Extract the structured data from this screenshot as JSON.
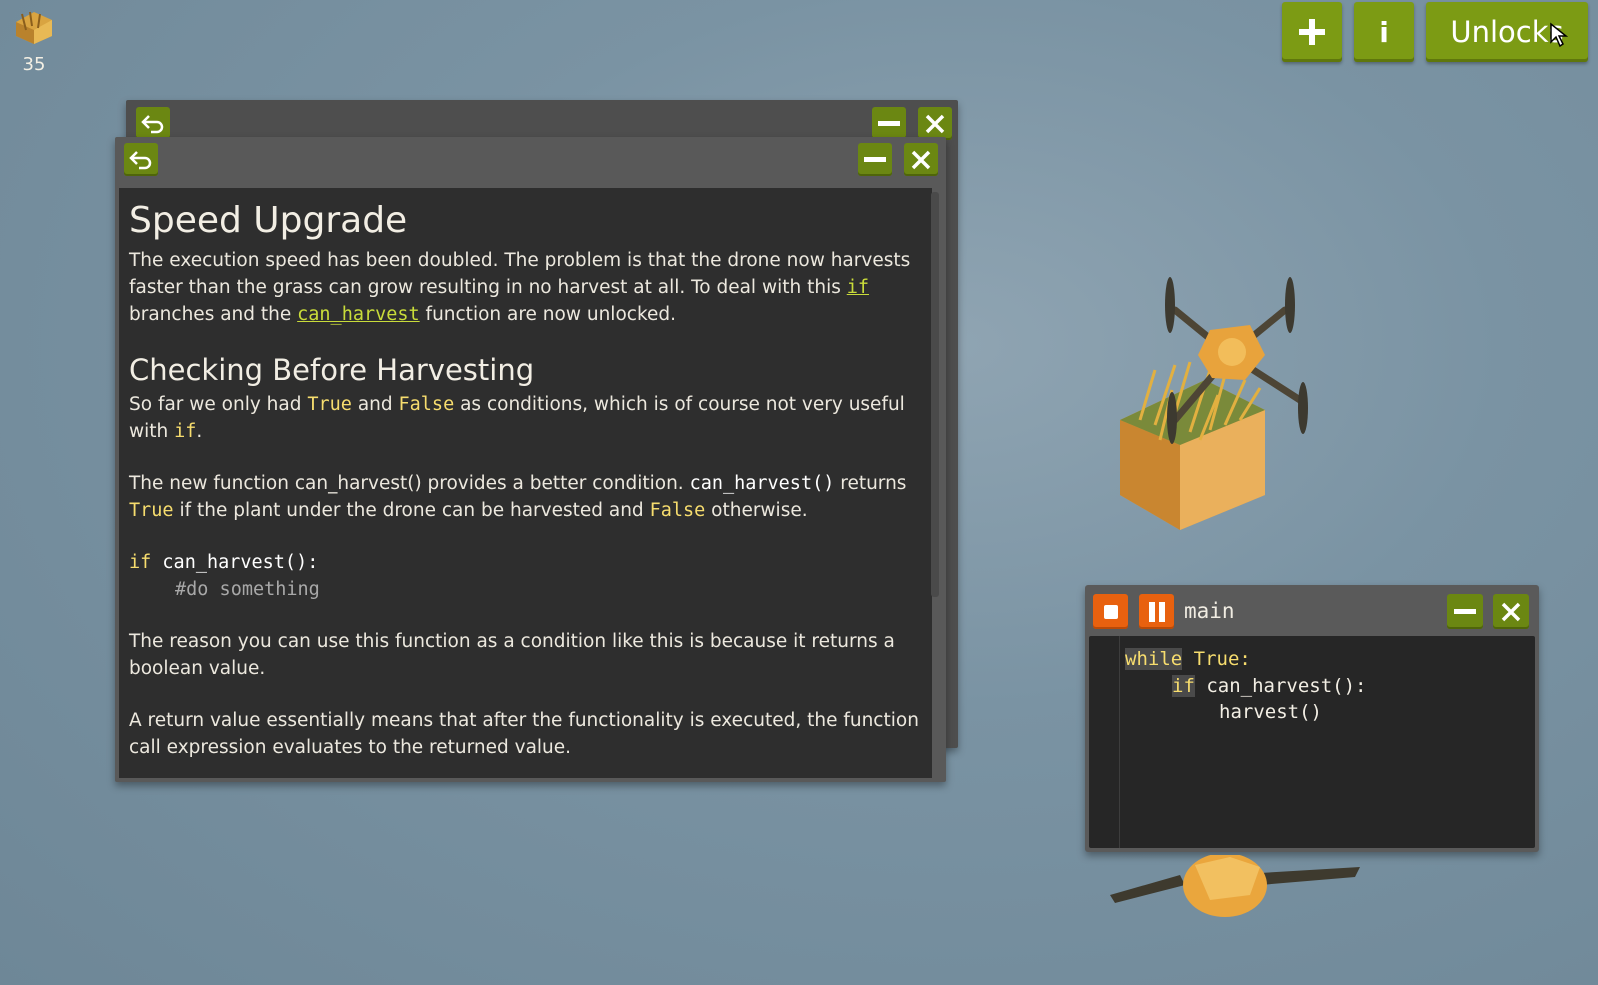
{
  "resources": {
    "hay_count": "35",
    "icon": "hay-bale-icon"
  },
  "top_bar": {
    "add_label": "+",
    "info_label": "i",
    "unlocks_label": "Unlocks"
  },
  "doc": {
    "title": "Speed Upgrade",
    "p1_a": "The execution speed has been doubled. The problem is that the drone now harvests faster than the grass can grow resulting in no harvest at all. To deal with this ",
    "p1_link1": "if",
    "p1_b": " branches and the ",
    "p1_link2": "can_harvest",
    "p1_c": " function are now unlocked.",
    "h2": "Checking Before Harvesting",
    "p2_a": "So far we only had ",
    "p2_true": "True",
    "p2_b": " and ",
    "p2_false": "False",
    "p2_c": " as conditions, which is of course not very useful with ",
    "p2_if": "if",
    "p2_d": ".",
    "p3_a": "The new function can_harvest() provides a better condition. ",
    "p3_code": "can_harvest()",
    "p3_b": " returns ",
    "p3_true": "True",
    "p3_c": " if the plant under the drone can be harvested and ",
    "p3_false": "False",
    "p3_d": " otherwise.",
    "code_if": "if",
    "code_call": " can_harvest():",
    "code_comment": "#do something",
    "p4": "The reason you can use this function as a condition like this is because it returns a boolean value.",
    "p5": "A return value essentially means that after the functionality is executed, the function call expression evaluates to the returned value."
  },
  "code_window": {
    "title": "main",
    "line1_kw": "while",
    "line1_rest": " True:",
    "line2_kw": "if",
    "line2_rest": " can_harvest():",
    "line3": "harvest()"
  },
  "colors": {
    "accent_green": "#7c9b14",
    "accent_orange": "#e8610f",
    "keyword_yellow": "#f7dd6e",
    "link_green": "#c9dc3a"
  }
}
